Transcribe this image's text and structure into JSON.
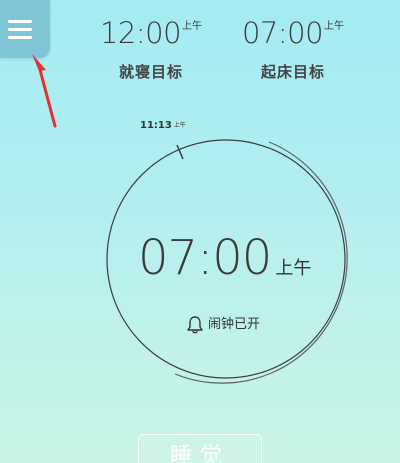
{
  "header": {
    "menu_icon": "hamburger-menu-icon",
    "sleep_target": {
      "time": "12:00",
      "ampm": "上午",
      "label": "就寝目标"
    },
    "wake_target": {
      "time": "07:00",
      "ampm": "上午",
      "label": "起床目标"
    }
  },
  "dial": {
    "current_time": "11:13",
    "current_ampm": "上午",
    "alarm_time": "07:00",
    "alarm_ampm": "上午",
    "alarm_status": "闹钟已开",
    "status_icon": "bell-icon"
  },
  "footer": {
    "sleep_button_label": "睡觉"
  },
  "colors": {
    "background_top": "#a3ecf2",
    "background_bottom": "#cbf5e6",
    "menu_button": "#7ec6d6",
    "annotation_arrow": "#e8302a",
    "dial_line": "#3c3c3c"
  }
}
